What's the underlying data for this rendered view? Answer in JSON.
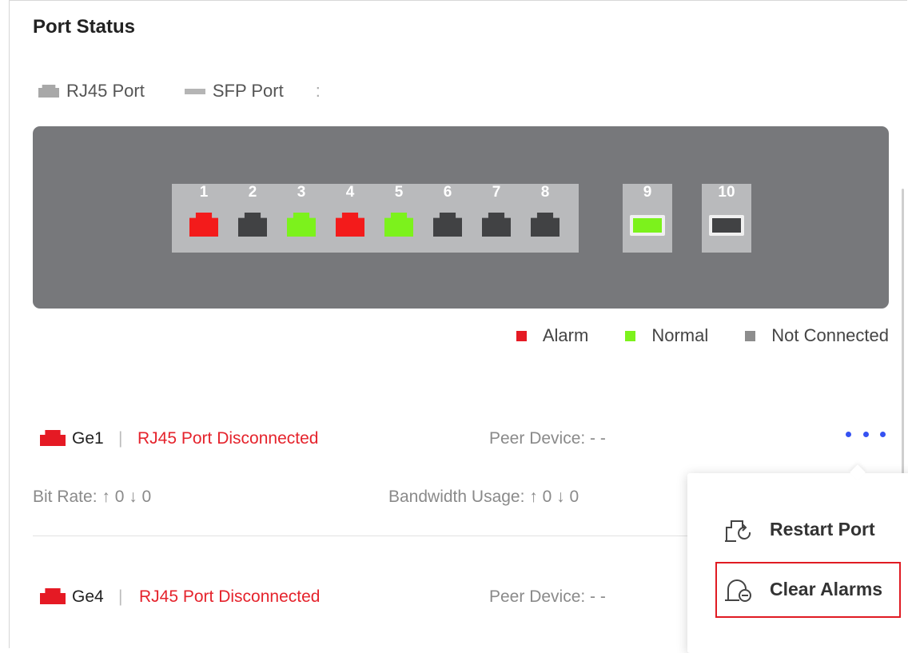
{
  "title": "Port Status",
  "type_legend": {
    "rj45": "RJ45 Port",
    "sfp": "SFP Port",
    "colon": ":"
  },
  "colors": {
    "alarm": "#f31b1b",
    "normal": "#7cf21c",
    "not_connected": "#414244",
    "panel": "#77787b",
    "link": "#3552f2"
  },
  "ports": [
    {
      "number": "1",
      "type": "rj45",
      "status": "alarm"
    },
    {
      "number": "2",
      "type": "rj45",
      "status": "not_connected"
    },
    {
      "number": "3",
      "type": "rj45",
      "status": "normal"
    },
    {
      "number": "4",
      "type": "rj45",
      "status": "alarm"
    },
    {
      "number": "5",
      "type": "rj45",
      "status": "normal"
    },
    {
      "number": "6",
      "type": "rj45",
      "status": "not_connected"
    },
    {
      "number": "7",
      "type": "rj45",
      "status": "not_connected"
    },
    {
      "number": "8",
      "type": "rj45",
      "status": "not_connected"
    },
    {
      "number": "9",
      "type": "sfp",
      "status": "normal"
    },
    {
      "number": "10",
      "type": "sfp",
      "status": "not_connected"
    }
  ],
  "status_legend": {
    "alarm": "Alarm",
    "normal": "Normal",
    "not_connected": "Not Connected"
  },
  "port_rows": [
    {
      "name": "Ge1",
      "separator": "|",
      "status": "RJ45 Port Disconnected",
      "peer_device": "Peer Device: - -",
      "bit_rate": "Bit Rate: ↑ 0 ↓ 0",
      "bandwidth": "Bandwidth Usage: ↑ 0 ↓ 0"
    },
    {
      "name": "Ge4",
      "separator": "|",
      "status": "RJ45 Port Disconnected",
      "peer_device": "Peer Device: - -"
    }
  ],
  "menu": {
    "restart": "Restart Port",
    "clear": "Clear Alarms"
  }
}
